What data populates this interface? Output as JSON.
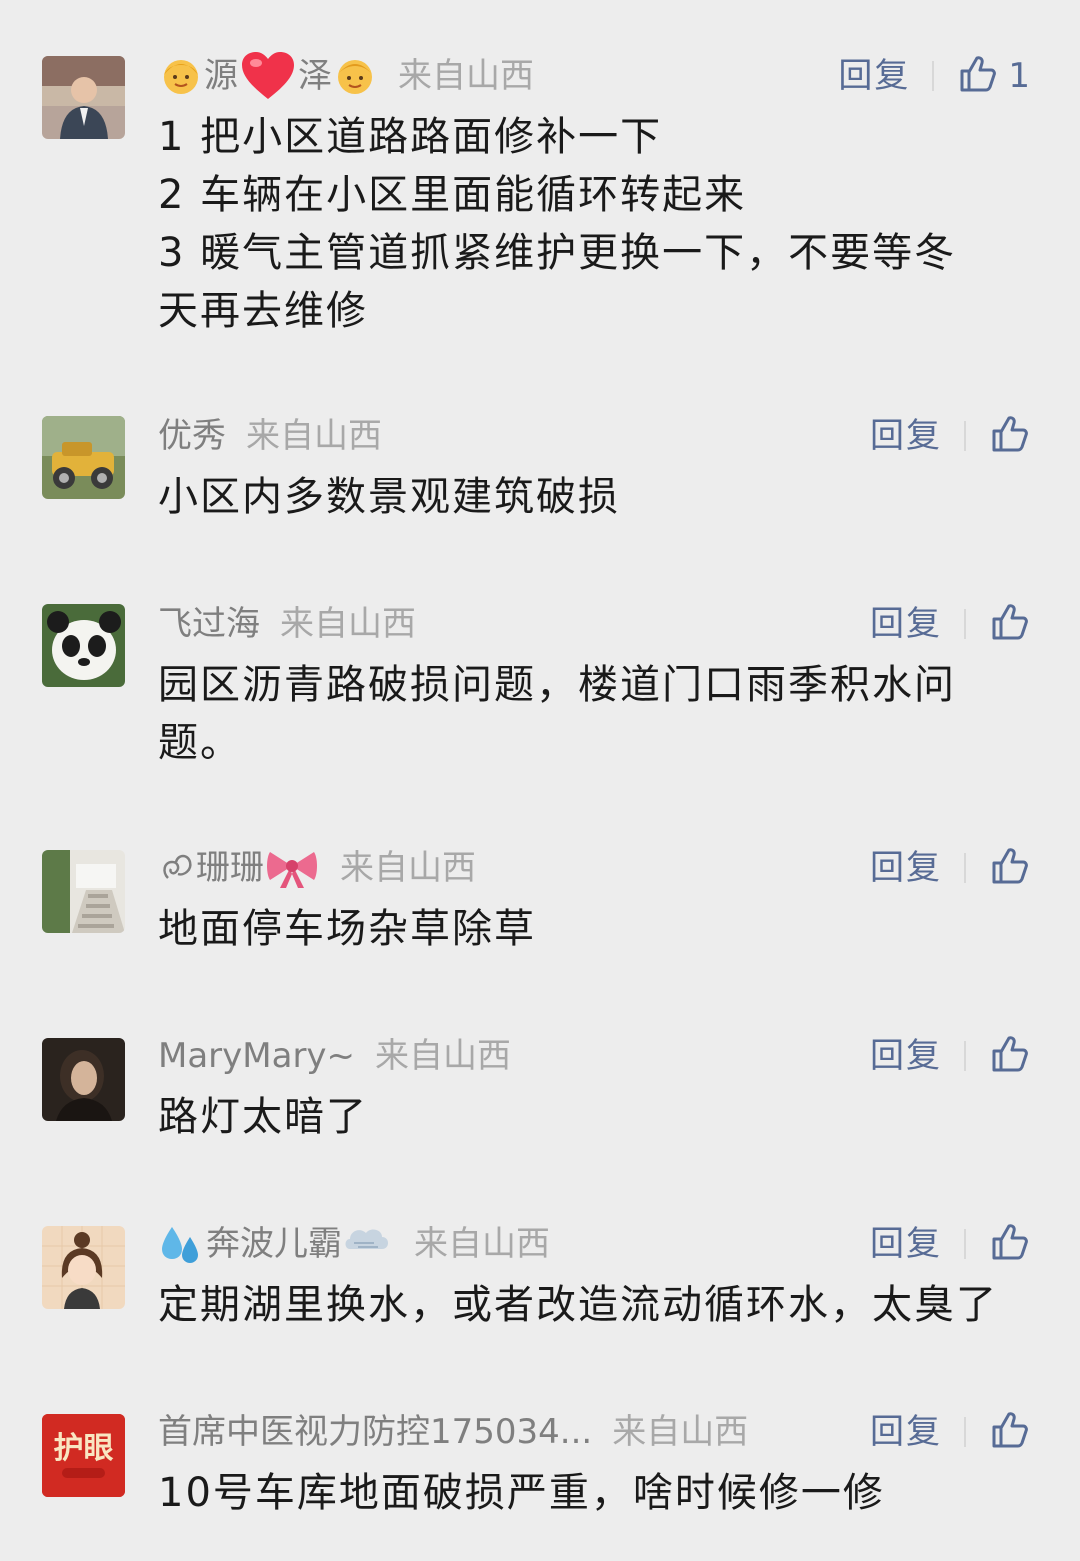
{
  "comments": [
    {
      "nickname_parts": [
        "源",
        "泽"
      ],
      "region": "来自山西",
      "reply_label": "回复",
      "like_count": "1",
      "lines": [
        "1  把小区道路路面修补一下",
        "2  车辆在小区里面能循环转起来",
        "3  暖气主管道抓紧维护更换一下，不要等冬",
        "天再去维修"
      ]
    },
    {
      "nickname": "优秀",
      "region": "来自山西",
      "reply_label": "回复",
      "lines": [
        "小区内多数景观建筑破损"
      ]
    },
    {
      "nickname": "飞过海",
      "region": "来自山西",
      "reply_label": "回复",
      "lines": [
        "园区沥青路破损问题，楼道门口雨季积水问",
        "题。"
      ]
    },
    {
      "nickname": "珊珊",
      "region": "来自山西",
      "reply_label": "回复",
      "lines": [
        "地面停车场杂草除草"
      ]
    },
    {
      "nickname": "MaryMary~",
      "region": "来自山西",
      "reply_label": "回复",
      "lines": [
        "路灯太暗了"
      ]
    },
    {
      "nickname": "奔波儿霸",
      "region": "来自山西",
      "reply_label": "回复",
      "lines": [
        "定期湖里换水，或者改造流动循环水，太臭了"
      ]
    },
    {
      "nickname": "首席中医视力防控175034...",
      "region": "来自山西",
      "reply_label": "回复",
      "avatar_text": "护眼",
      "lines": [
        "10号车库地面破损严重，啥时候修一修"
      ]
    }
  ],
  "icons": {
    "like": "thumbs-up-icon",
    "accent_color": "#576b95"
  }
}
